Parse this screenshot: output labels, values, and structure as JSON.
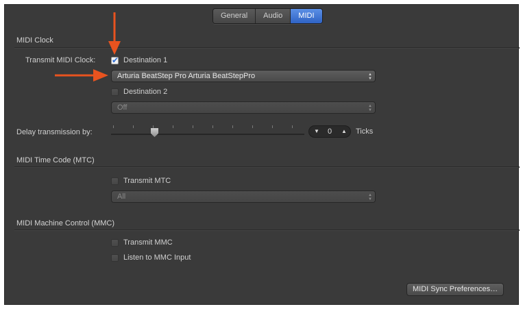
{
  "tabs": [
    "General",
    "Audio",
    "MIDI"
  ],
  "active_tab": "MIDI",
  "accent_color": "#2f63c4",
  "arrow_color": "#e8531f",
  "midi_clock": {
    "section_title": "MIDI Clock",
    "transmit_label": "Transmit MIDI Clock:",
    "destination1": {
      "label": "Destination 1",
      "checked": true
    },
    "destination1_value": "Arturia BeatStep Pro Arturia BeatStepPro",
    "destination2": {
      "label": "Destination 2",
      "checked": false
    },
    "destination2_value": "Off",
    "delay_label": "Delay transmission by:",
    "delay_value": "0",
    "delay_unit": "Ticks"
  },
  "mtc": {
    "section_title": "MIDI Time Code (MTC)",
    "transmit_label": "Transmit MTC",
    "transmit_checked": false,
    "destination_value": "All"
  },
  "mmc": {
    "section_title": "MIDI Machine Control (MMC)",
    "transmit_label": "Transmit MMC",
    "transmit_checked": false,
    "listen_label": "Listen to MMC Input",
    "listen_checked": false
  },
  "sync_button": "MIDI Sync Preferences…",
  "icons": {
    "checkbox_checked": "checkmark-icon",
    "popup": "updown-chevron-icon",
    "stepper_down": "triangle-down-icon",
    "stepper_up": "triangle-up-icon",
    "annotation": "red-arrow-icon"
  }
}
